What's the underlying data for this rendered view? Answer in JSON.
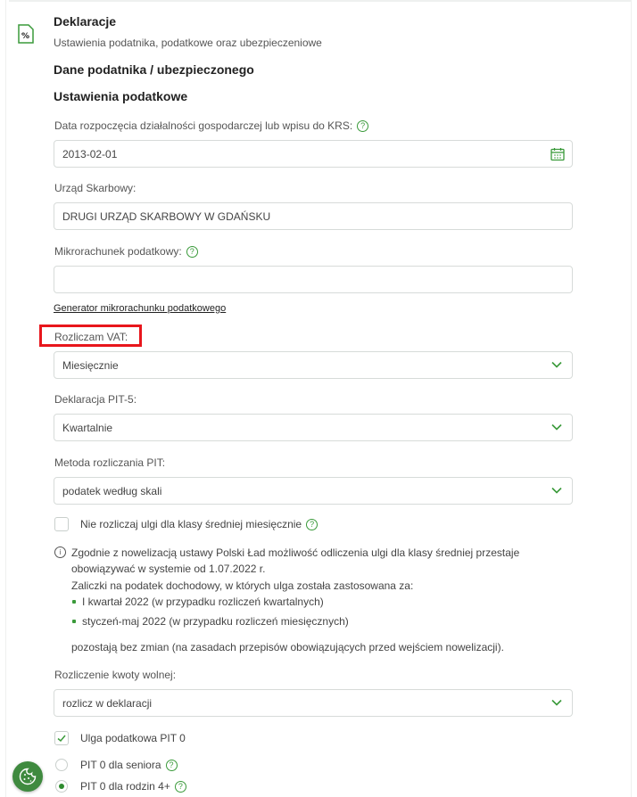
{
  "header": {
    "title": "Deklaracje",
    "subtitle": "Ustawienia podatnika, podatkowe oraz ubezpieczeniowe",
    "icon": "percent-document-icon"
  },
  "sections": {
    "taxpayer_data": "Dane podatnika / ubezpieczonego",
    "tax_settings": "Ustawienia podatkowe"
  },
  "fields": {
    "start_date": {
      "label": "Data rozpoczęcia działalności gospodarczej lub wpisu do KRS:",
      "value": "2013-02-01",
      "icon": "calendar-icon"
    },
    "tax_office": {
      "label": "Urząd Skarbowy:",
      "value": "DRUGI URZĄD SKARBOWY W GDAŃSKU"
    },
    "micro_account": {
      "label": "Mikrorachunek podatkowy:",
      "value": ""
    },
    "micro_account_link": "Generator mikrorachunku podatkowego",
    "vat": {
      "label": "Rozliczam VAT:",
      "value": "Miesięcznie"
    },
    "pit5": {
      "label": "Deklaracja PIT-5:",
      "value": "Kwartalnie"
    },
    "pit_method": {
      "label": "Metoda rozliczania PIT:",
      "value": "podatek według skali"
    },
    "no_middle_class_relief": {
      "label": "Nie rozliczaj ulgi dla klasy średniej miesięcznie",
      "checked": false
    },
    "free_amount": {
      "label": "Rozliczenie kwoty wolnej:",
      "value": "rozlicz w deklaracji"
    },
    "pit0_relief": {
      "label": "Ulga podatkowa PIT 0",
      "checked": true
    },
    "pit0_options": [
      {
        "label": "PIT 0 dla seniora",
        "selected": false
      },
      {
        "label": "PIT 0 dla rodzin 4+",
        "selected": true
      }
    ]
  },
  "info_note": {
    "line1": "Zgodnie z nowelizacją ustawy Polski Ład możliwość odliczenia ulgi dla klasy średniej przestaje",
    "line2": "obowiązywać w systemie od 1.07.2022 r.",
    "line3": "Zaliczki na podatek dochodowy, w których ulga została zastosowana za:",
    "bullets": [
      "I kwartał 2022 (w przypadku rozliczeń kwartalnych)",
      "styczeń-maj 2022 (w przypadku rozliczeń miesięcznych)"
    ],
    "footer": "pozostają bez zmian (na zasadach przepisów obowiązujących przed wejściem nowelizacji)."
  },
  "colors": {
    "accent": "#3a9a3a",
    "highlight": "#e8161c",
    "border": "#d7dbd9"
  }
}
